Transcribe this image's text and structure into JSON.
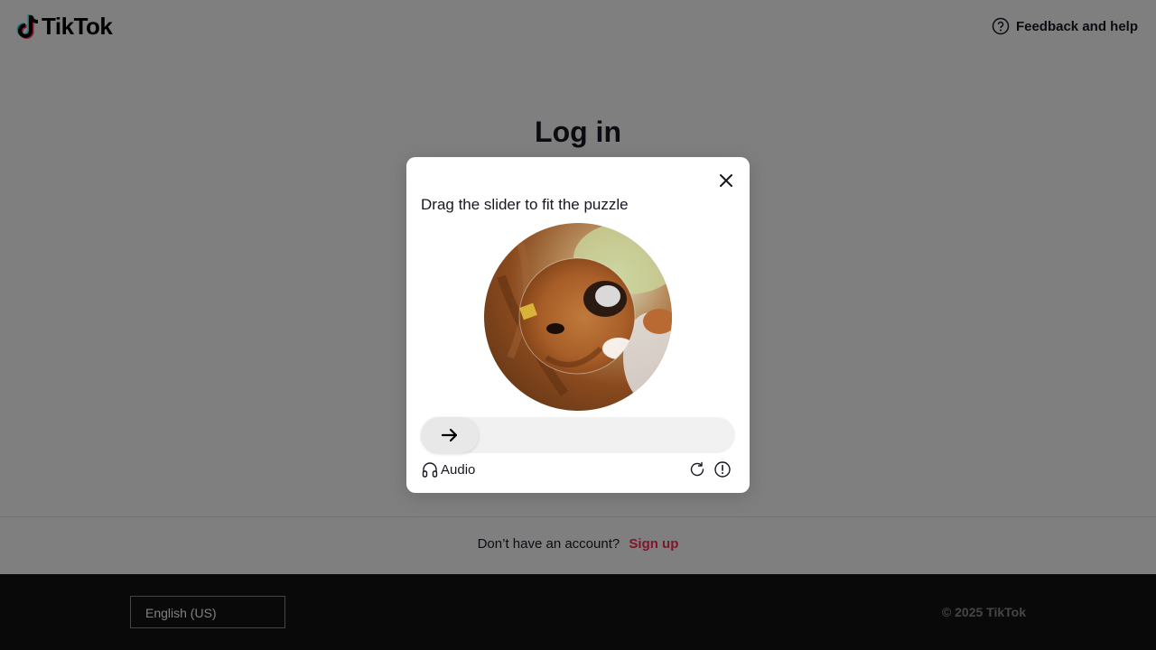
{
  "header": {
    "logo_text": "TikTok",
    "feedback_label": "Feedback and help"
  },
  "main": {
    "title": "Log in"
  },
  "signup": {
    "prompt": "Don’t have an account?",
    "link_label": "Sign up"
  },
  "footer": {
    "language": "English (US)",
    "copyright": "© 2025 TikTok"
  },
  "captcha": {
    "title": "Drag the slider to fit the puzzle",
    "audio_label": "Audio",
    "slider_progress": 0,
    "icons": [
      "close-icon",
      "arrow-right-icon",
      "headphones-icon",
      "refresh-icon",
      "info-icon"
    ]
  },
  "colors": {
    "brand_red": "#fe2c55",
    "brand_cyan": "#25f4ee",
    "text": "#161823",
    "footer_bg": "#121212"
  }
}
